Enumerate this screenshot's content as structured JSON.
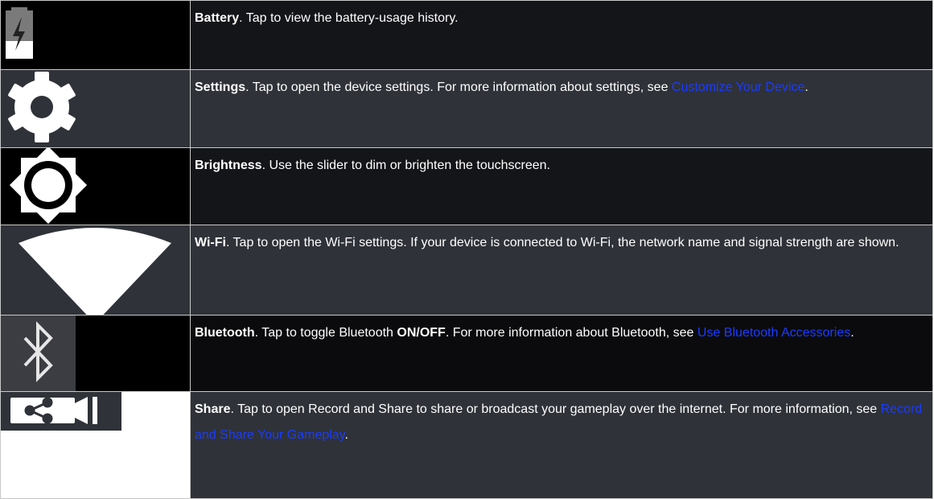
{
  "rows": [
    {
      "icon": "battery-charging-icon",
      "term": "Battery",
      "text": ". Tap to view the battery-usage history."
    },
    {
      "icon": "gear-icon",
      "term": "Settings",
      "text": ". Tap to open the device settings. For more information about settings, see ",
      "link": "Customize Your Device",
      "after": "."
    },
    {
      "icon": "brightness-icon",
      "term": "Brightness",
      "text": ". Use the slider to dim or brighten the touchscreen."
    },
    {
      "icon": "wifi-icon",
      "term": "Wi-Fi",
      "text": ". Tap to open the Wi-Fi settings. If your device is connected to Wi-Fi, the network name and signal strength are shown."
    },
    {
      "icon": "bluetooth-icon",
      "term": "Bluetooth",
      "text": ". Tap to toggle Bluetooth ",
      "strong": "ON/OFF",
      "text2": ". For more information about Bluetooth, see ",
      "link": "Use Bluetooth Accessories",
      "after": "."
    },
    {
      "icon": "share-icon",
      "term": "Share",
      "text": ". Tap to open Record and Share to share or broadcast your gameplay over the internet. For more information, see ",
      "link": "Record and Share Your Gameplay",
      "after": "."
    }
  ],
  "colors": {
    "link": "#1a3cff",
    "dark_row": "#141519",
    "gray_row": "#2f3238"
  }
}
